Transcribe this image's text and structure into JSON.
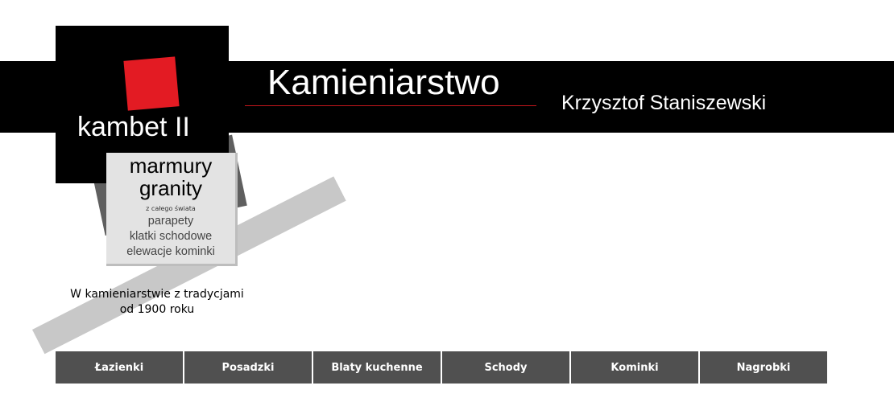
{
  "header": {
    "title": "Kamieniarstwo",
    "owner": "Krzysztof Staniszewski"
  },
  "logo": {
    "brand": "kambet II"
  },
  "offer_box": {
    "line1": "marmury",
    "line2": "granity",
    "origin": "z całego świata",
    "item1": "parapety",
    "item2": "klatki schodowe",
    "item3": "elewacje kominki"
  },
  "tagline": {
    "line1": "W kamieniarstwie z tradycjami",
    "line2": "od 1900 roku"
  },
  "nav": {
    "items": [
      {
        "label": "Łazienki"
      },
      {
        "label": "Posadzki"
      },
      {
        "label": "Blaty kuchenne"
      },
      {
        "label": "Schody"
      },
      {
        "label": "Kominki"
      },
      {
        "label": "Nagrobki"
      }
    ]
  },
  "colors": {
    "band": "#000000",
    "accent_red": "#e31b23",
    "nav_bg": "#505050",
    "stripe": "#c8c8c8"
  }
}
